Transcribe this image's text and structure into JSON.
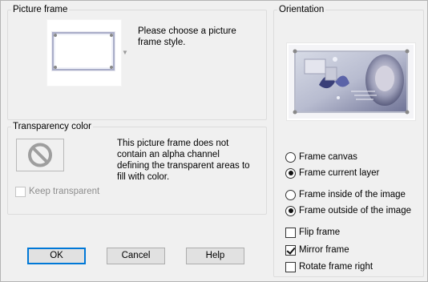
{
  "picture_frame": {
    "title": "Picture frame",
    "description": "Please choose a picture\nframe style.",
    "dropdown_icon": "chevron-down-icon"
  },
  "transparency": {
    "title": "Transparency color",
    "description": "This picture frame does not\ncontain an alpha channel\ndefining the transparent areas to\nfill with color.",
    "swatch_icon": "no-entry-icon",
    "keep_transparent": {
      "label": "Keep transparent",
      "checked": false,
      "enabled": false
    }
  },
  "orientation": {
    "title": "Orientation",
    "radios_group1": [
      {
        "label": "Frame canvas",
        "checked": false
      },
      {
        "label": "Frame current layer",
        "checked": true
      }
    ],
    "radios_group2": [
      {
        "label": "Frame inside of the image",
        "checked": false
      },
      {
        "label": "Frame outside of the image",
        "checked": true
      }
    ],
    "checkboxes": [
      {
        "label": "Flip frame",
        "checked": false
      },
      {
        "label": "Mirror frame",
        "checked": true
      },
      {
        "label": "Rotate frame right",
        "checked": false
      }
    ]
  },
  "buttons": {
    "ok": "OK",
    "cancel": "Cancel",
    "help": "Help"
  },
  "colors": {
    "dialog_bg": "#f0f0f0",
    "default_button_border": "#0078d7",
    "frame_border": "#a9adc8"
  }
}
